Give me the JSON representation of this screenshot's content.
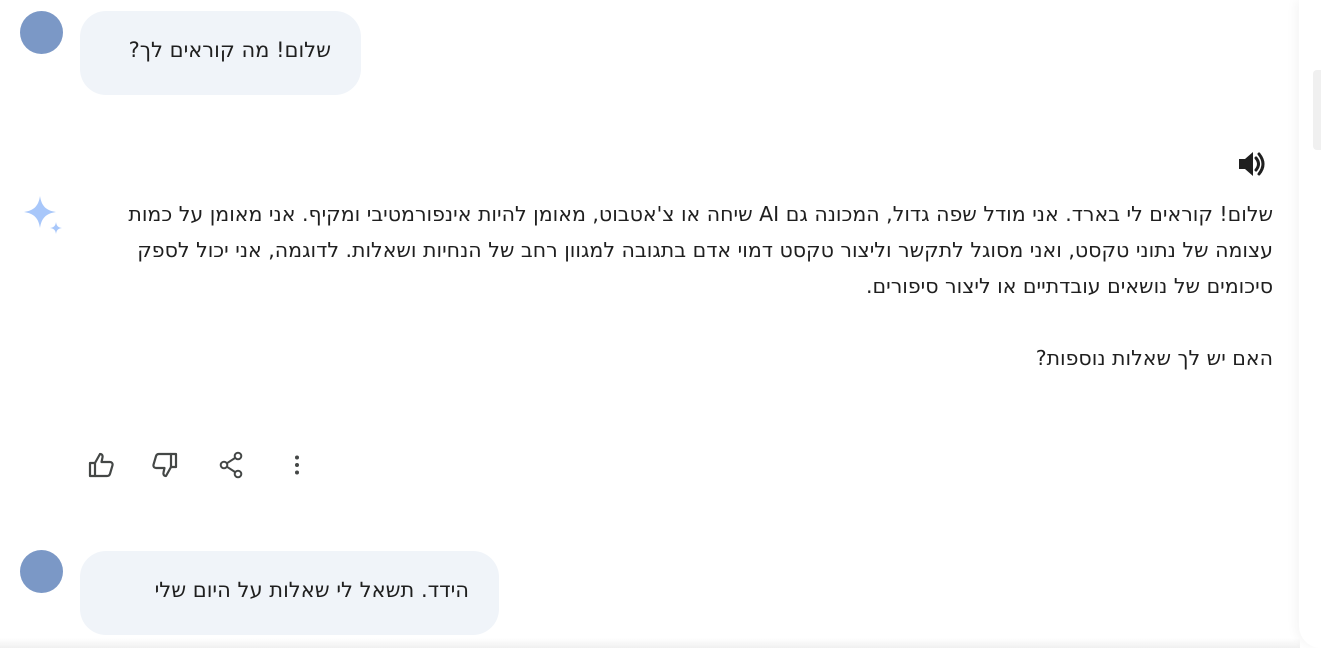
{
  "conversation": {
    "user_message_1": "שלום! מה קוראים לך?",
    "model_response": {
      "paragraph_1": "שלום! קוראים לי בארד. אני מודל שפה גדול, המכונה גם AI שיחה או צ'אטבוט, מאומן להיות אינפורמטיבי ומקיף. אני מאומן על כמות עצומה של נתוני טקסט, ואני מסוגל לתקשר וליצור טקסט דמוי אדם בתגובה למגוון רחב של הנחיות ושאלות. לדוגמה, אני יכול לספק סיכומים של נושאים עובדתיים או ליצור סיפורים.",
      "paragraph_2": "האם יש לך שאלות נוספות?"
    },
    "user_message_2": "הידד. תשאל לי שאלות על היום שלי"
  },
  "icons": {
    "speaker": "volume-icon",
    "model": "sparkle-icon",
    "like": "thumbs-up-icon",
    "dislike": "thumbs-down-icon",
    "share": "share-icon",
    "more": "more-vert-icon"
  },
  "colors": {
    "avatar": "#7b98c6",
    "bubble_bg": "#f0f4f9",
    "sparkle": "#a8c7fa",
    "text": "#1f1f1f",
    "icon": "#444746"
  }
}
